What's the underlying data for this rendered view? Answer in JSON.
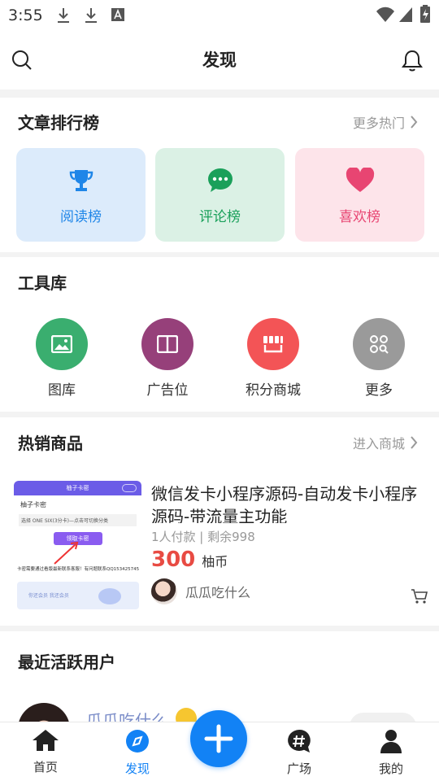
{
  "status_bar": {
    "time": "3:55"
  },
  "header": {
    "title": "发现"
  },
  "ranking": {
    "title": "文章排行榜",
    "more": "更多热门",
    "items": [
      {
        "label": "阅读榜",
        "icon": "trophy-icon",
        "color": "#1f86e8",
        "bg": "#dcebfb"
      },
      {
        "label": "评论榜",
        "icon": "comment-icon",
        "color": "#1aa05a",
        "bg": "#dbf1e5"
      },
      {
        "label": "喜欢榜",
        "icon": "heart-icon",
        "color": "#e84572",
        "bg": "#fde4ea"
      }
    ]
  },
  "tools": {
    "title": "工具库",
    "items": [
      {
        "label": "图库",
        "icon": "image-icon",
        "color": "#3aae6f"
      },
      {
        "label": "广告位",
        "icon": "book-icon",
        "color": "#96407a"
      },
      {
        "label": "积分商城",
        "icon": "shop-icon",
        "color": "#f35456"
      },
      {
        "label": "更多",
        "icon": "grid-icon",
        "color": "#9a9a9a"
      }
    ]
  },
  "hot": {
    "title": "热销商品",
    "more": "进入商城",
    "product": {
      "title": "微信发卡小程序源码-自动发卡小程序源码-带流量主功能",
      "sales": "1人付款 | 剩余998",
      "price": "300",
      "unit": "柚币",
      "seller": "瓜瓜吃什么",
      "thumb": {
        "header": "柚子卡密",
        "label": "柚子卡密",
        "select_text": "选择 ONE SIX(3分卡)—点击可切换分类",
        "button": "领取卡密",
        "notice": "卡密需要通过看版最新联系客服！有问题联系QQ1534257456",
        "footer_text": "你还会员 我还会员"
      }
    }
  },
  "active": {
    "title": "最近活跃用户",
    "user": "瓜瓜吃什么"
  },
  "tabbar": {
    "items": [
      {
        "label": "首页",
        "icon": "home-icon"
      },
      {
        "label": "发现",
        "icon": "compass-icon",
        "active": true
      },
      {
        "label": "广场",
        "icon": "hashtag-icon"
      },
      {
        "label": "我的",
        "icon": "user-icon"
      }
    ]
  }
}
